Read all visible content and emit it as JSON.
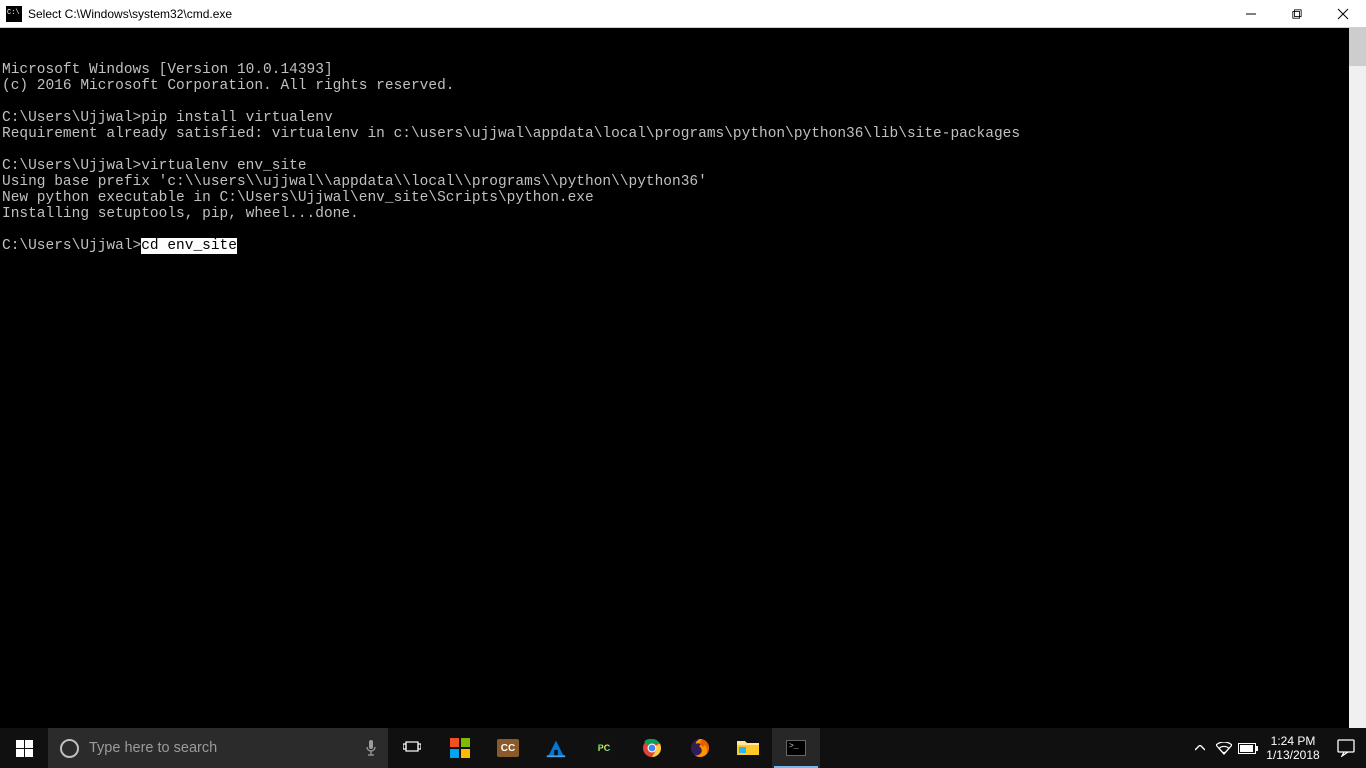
{
  "window": {
    "title": "Select C:\\Windows\\system32\\cmd.exe"
  },
  "console": {
    "lines": [
      "Microsoft Windows [Version 10.0.14393]",
      "(c) 2016 Microsoft Corporation. All rights reserved.",
      "",
      "C:\\Users\\Ujjwal>pip install virtualenv",
      "Requirement already satisfied: virtualenv in c:\\users\\ujjwal\\appdata\\local\\programs\\python\\python36\\lib\\site-packages",
      "",
      "C:\\Users\\Ujjwal>virtualenv env_site",
      "Using base prefix 'c:\\\\users\\\\ujjwal\\\\appdata\\\\local\\\\programs\\\\python\\\\python36'",
      "New python executable in C:\\Users\\Ujjwal\\env_site\\Scripts\\python.exe",
      "Installing setuptools, pip, wheel...done.",
      ""
    ],
    "final_prompt": "C:\\Users\\Ujjwal>",
    "final_input_selected": "cd env_site"
  },
  "taskbar": {
    "search_placeholder": "Type here to search",
    "time": "1:24 PM",
    "date": "1/13/2018",
    "cc_label": "CC",
    "pycharm_label": "PC"
  }
}
